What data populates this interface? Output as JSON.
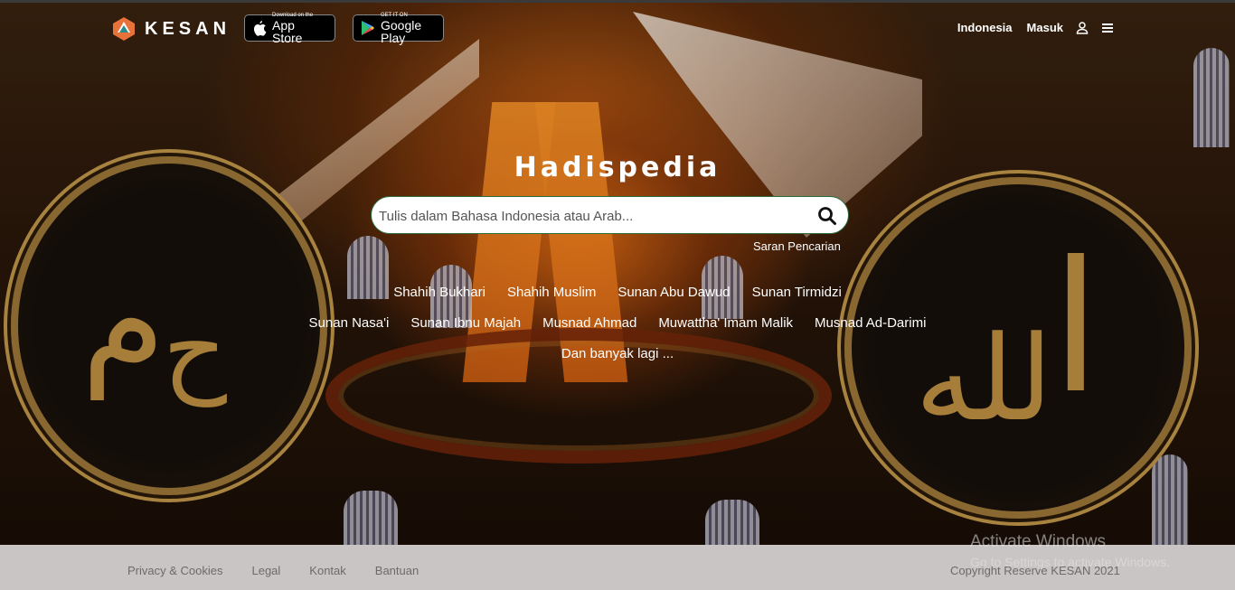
{
  "header": {
    "brand": "KESAN",
    "app_store": {
      "small": "Download on the",
      "big": "App Store"
    },
    "google_play": {
      "small": "GET IT ON",
      "big": "Google Play"
    },
    "nav": {
      "language": "Indonesia",
      "login": "Masuk"
    }
  },
  "main": {
    "title": "Hadispedia",
    "search": {
      "placeholder": "Tulis dalam Bahasa Indonesia atau Arab..."
    },
    "suggest_link": "Saran Pencarian",
    "collections_row1": [
      "Shahih Bukhari",
      "Shahih Muslim",
      "Sunan Abu Dawud",
      "Sunan Tirmidzi"
    ],
    "collections_row2": [
      "Sunan Nasa'i",
      "Sunan Ibnu Majah",
      "Musnad Ahmad",
      "Muwattha' Imam Malik",
      "Musnad Ad-Darimi"
    ],
    "more": "Dan banyak lagi ..."
  },
  "footer": {
    "links": [
      "Privacy & Cookies",
      "Legal",
      "Kontak",
      "Bantuan"
    ],
    "copyright": "Copyright Reserve KESAN 2021"
  },
  "overlay": {
    "activate_title": "Activate Windows",
    "activate_sub": "Go to Settings to activate Windows."
  },
  "colors": {
    "accent_border": "#2a6b3a",
    "footer_bg": "#c9c5c4",
    "logo_orange": "#e8733a",
    "logo_teal": "#2f8a8a"
  }
}
